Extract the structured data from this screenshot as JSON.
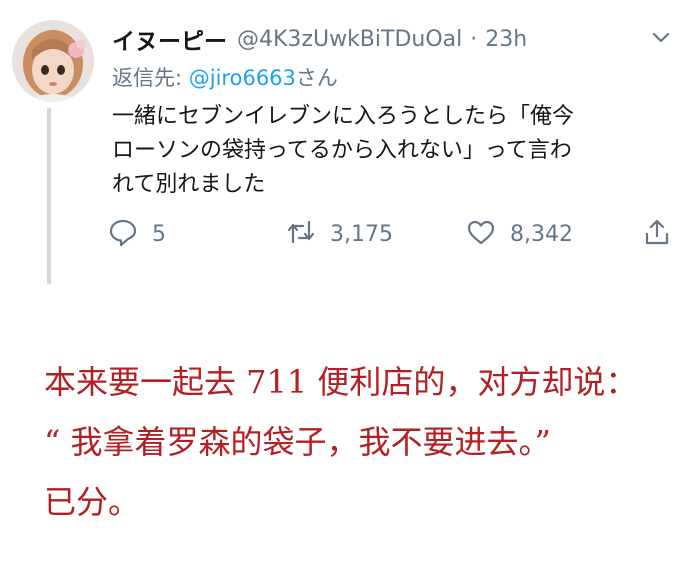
{
  "tweet": {
    "display_name": "イヌーピー",
    "handle": "@4K3zUwkBiTDuOal",
    "separator": "·",
    "time": "23h",
    "reply_prefix": "返信先: ",
    "reply_mention": "@jiro6663",
    "reply_suffix": "さん",
    "text_lines": [
      "一緒にセブンイレブンに入ろうとしたら「俺今",
      "ローソンの袋持ってるから入れない」って言わ",
      "れて別れました"
    ],
    "replies": "5",
    "retweets": "3,175",
    "likes": "8,342"
  },
  "caption": {
    "lines": [
      "本来要一起去 711 便利店的，对方却说：",
      "“ 我拿着罗森的袋子，我不要进去。”",
      "已分。"
    ]
  },
  "colors": {
    "name": "#14171a",
    "meta": "#657786",
    "mention": "#1da1f2",
    "caption": "#b32024",
    "thread_line": "#d4d8dc"
  },
  "icons": [
    "avatar",
    "chevron-down-icon",
    "reply-icon",
    "retweet-icon",
    "heart-icon",
    "share-icon"
  ]
}
